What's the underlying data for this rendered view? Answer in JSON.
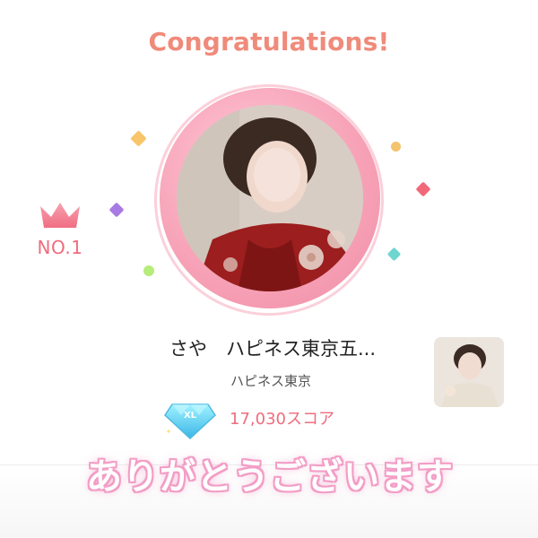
{
  "header": {
    "title": "Congratulations!"
  },
  "rank": {
    "label": "NO.1",
    "icon": "crown-icon"
  },
  "profile": {
    "name_line": "さや　ハピネス東京五...",
    "shop": "ハピネス東京",
    "score": "17,030スコア",
    "rank_badge_icon": "diamond-icon"
  },
  "overlay": {
    "thanks_text": "ありがとうございます"
  },
  "colors": {
    "title": "#f08a7a",
    "accent_pink": "#ef6c7e",
    "ring": "#f7a3b8"
  }
}
